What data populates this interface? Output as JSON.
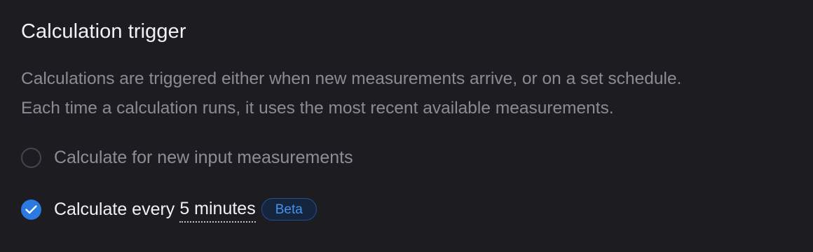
{
  "section": {
    "title": "Calculation trigger",
    "description_lines": [
      "Calculations are triggered either when new measurements arrive, or on a set schedule.",
      "Each time a calculation runs, it uses the most recent available measurements."
    ]
  },
  "options": [
    {
      "label": "Calculate for new input measurements",
      "selected": false
    },
    {
      "label": "Calculate every",
      "interval": "5 minutes",
      "badge": "Beta",
      "selected": true
    }
  ],
  "colors": {
    "background": "#1d1d21",
    "accent": "#2a7ae2",
    "badge_text": "#4791ef",
    "badge_bg": "#14253d",
    "badge_border": "#25508f",
    "muted_text": "#8b8b95"
  },
  "icons": {
    "selected_option": "checkmark-icon"
  }
}
